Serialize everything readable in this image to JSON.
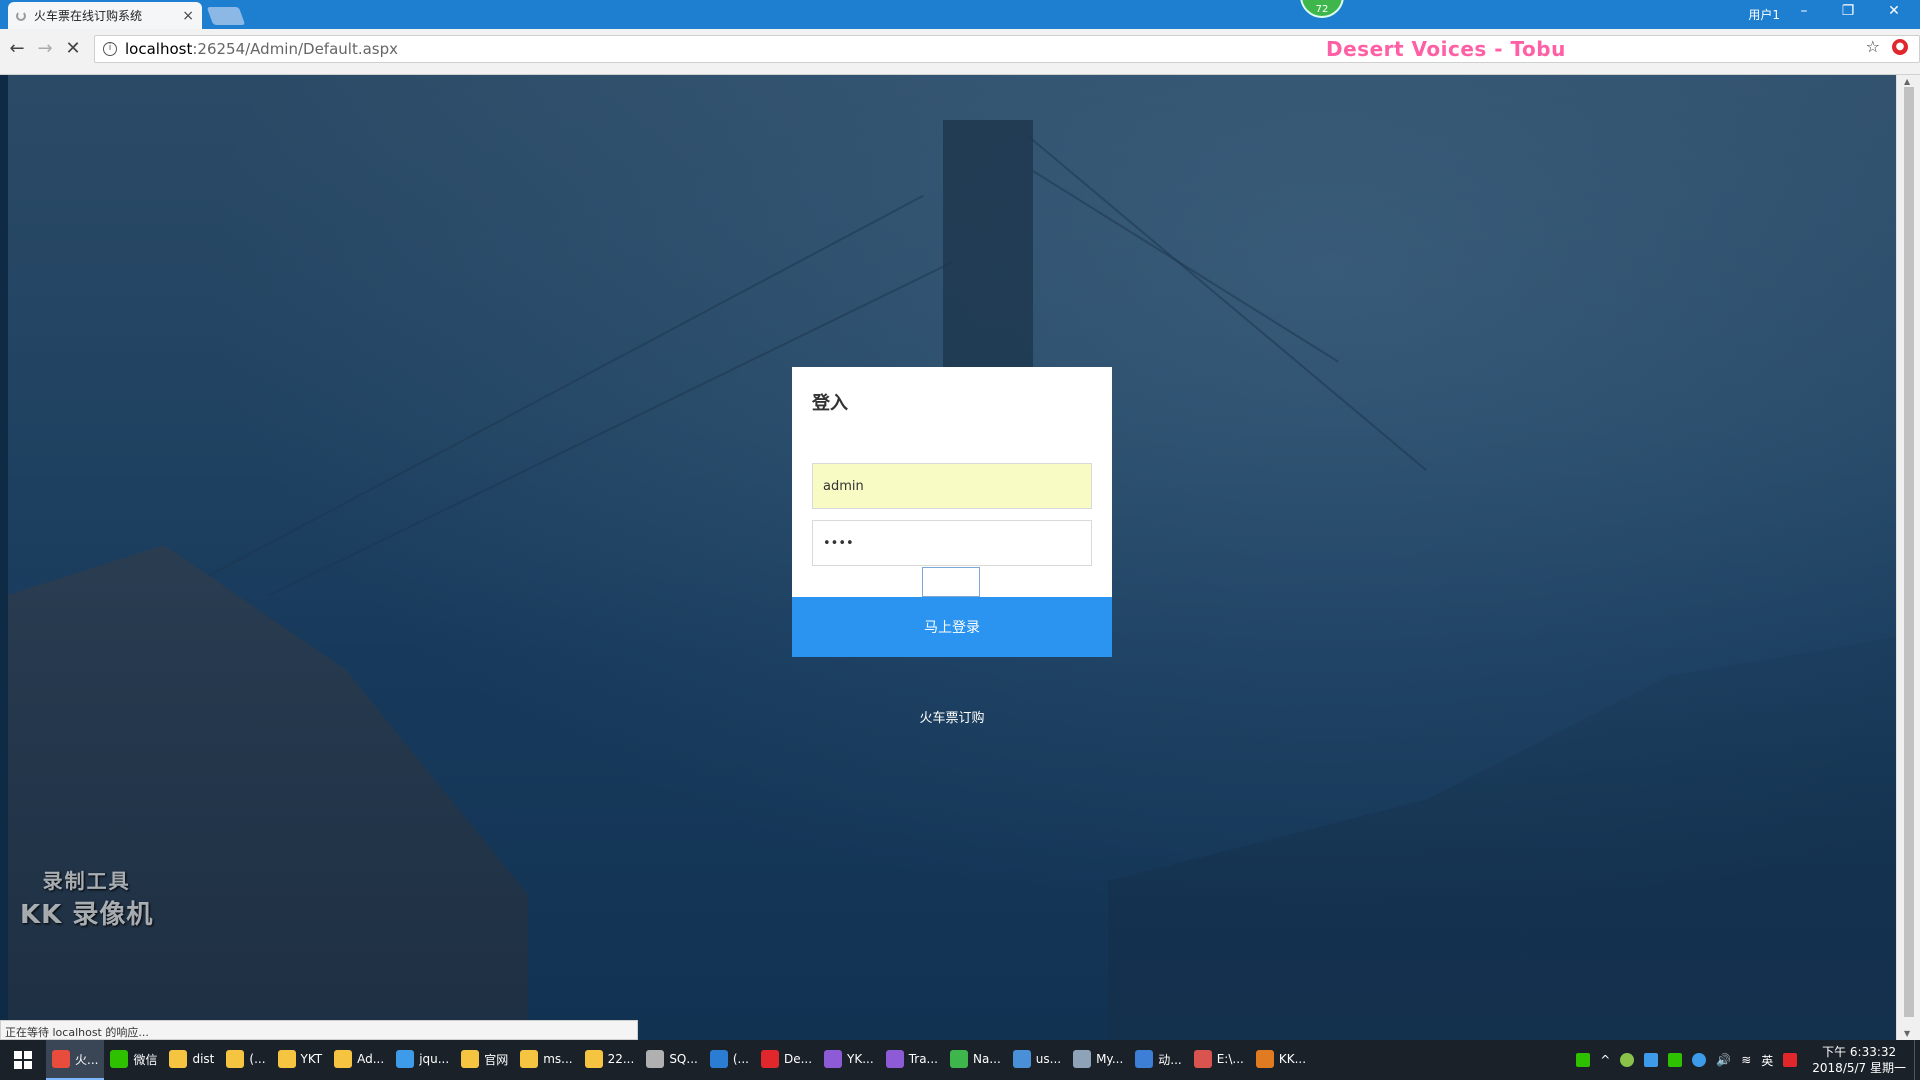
{
  "browser": {
    "tab_title": "火车票在线订购系统",
    "tab_close": "×",
    "update_badge": "72",
    "window_user": "用户1",
    "url_host": "localhost",
    "url_path": ":26254/Admin/Default.aspx",
    "now_playing": "Desert Voices - Tobu",
    "status_text": "正在等待 localhost 的响应..."
  },
  "login": {
    "title": "登入",
    "username_value": "admin",
    "password_value": "••••",
    "submit_label": "马上登录",
    "footer_link": "火车票订购"
  },
  "watermark": {
    "line1": "录制工具",
    "line2": "KK 录像机"
  },
  "taskbar": {
    "items": [
      {
        "label": "火...",
        "color": "#e74c3c",
        "active": true
      },
      {
        "label": "微信",
        "color": "#2dc100"
      },
      {
        "label": "dist",
        "color": "#f5c542"
      },
      {
        "label": "(...",
        "color": "#f5c542"
      },
      {
        "label": "YKT",
        "color": "#f5c542"
      },
      {
        "label": "Ad...",
        "color": "#f5c542"
      },
      {
        "label": "jqu...",
        "color": "#3d9be9"
      },
      {
        "label": "官网",
        "color": "#f5c542"
      },
      {
        "label": "ms...",
        "color": "#f5c542"
      },
      {
        "label": "22...",
        "color": "#f5c542"
      },
      {
        "label": "SQ...",
        "color": "#b0b0b0"
      },
      {
        "label": "(...",
        "color": "#2b7cd3"
      },
      {
        "label": "De...",
        "color": "#e0282c"
      },
      {
        "label": "YK...",
        "color": "#8e5bd6"
      },
      {
        "label": "Tra...",
        "color": "#8e5bd6"
      },
      {
        "label": "Na...",
        "color": "#3fb64b"
      },
      {
        "label": "us...",
        "color": "#4a90d9"
      },
      {
        "label": "My...",
        "color": "#8fa3b8"
      },
      {
        "label": "动...",
        "color": "#3d7fd6"
      },
      {
        "label": "E:\\...",
        "color": "#d9534f"
      },
      {
        "label": "KK...",
        "color": "#e07b22"
      }
    ],
    "tray_lang": "英",
    "clock_time": "下午 6:33:32",
    "clock_date": "2018/5/7 星期一"
  }
}
